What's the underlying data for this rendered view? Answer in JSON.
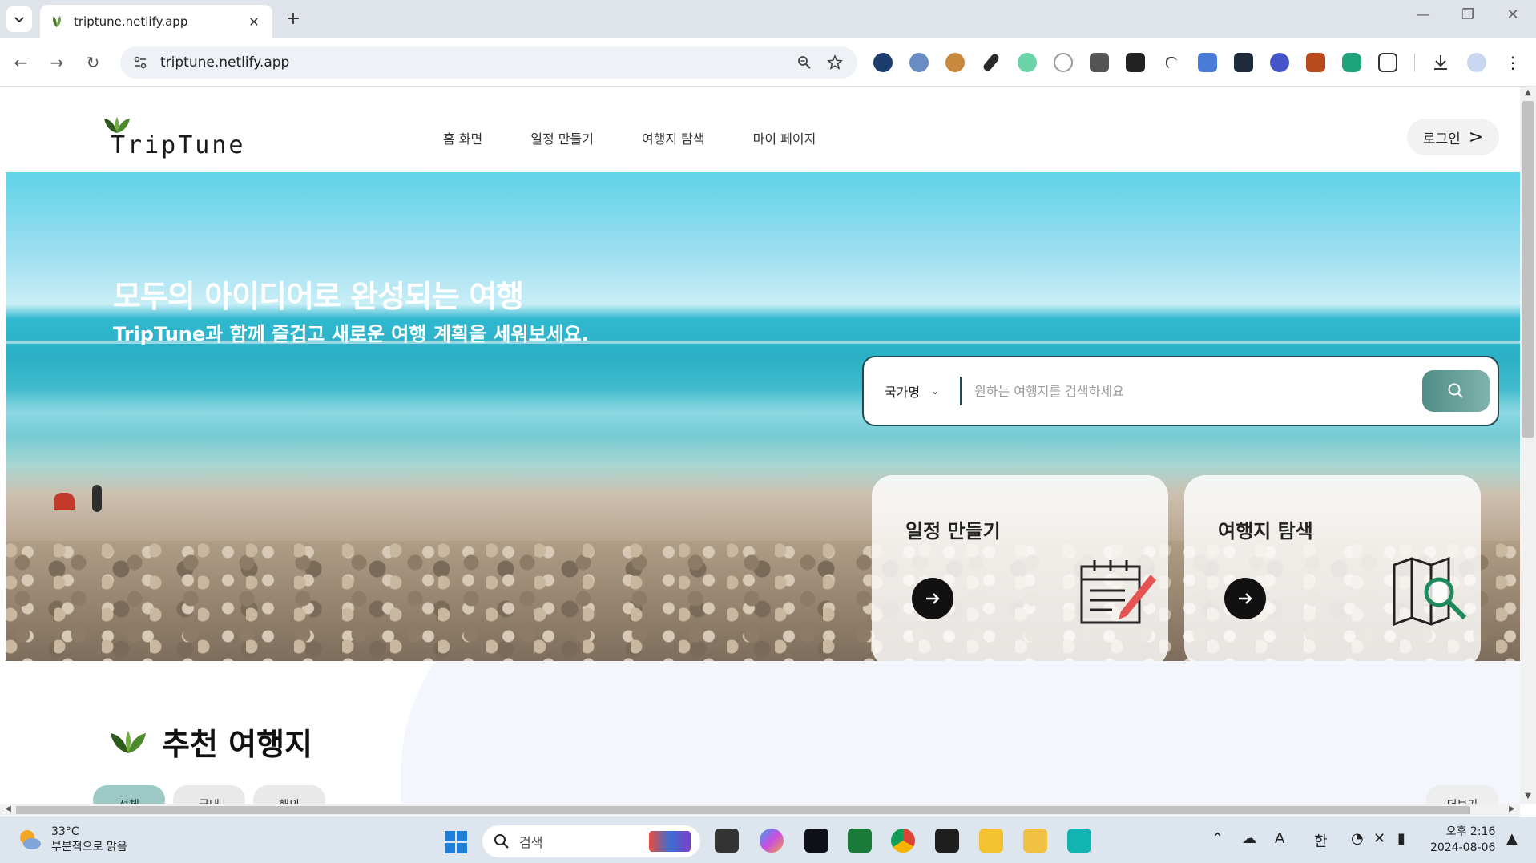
{
  "browser": {
    "tab_title": "triptune.netlify.app",
    "url": "triptune.netlify.app",
    "new_tab_symbol": "+",
    "close_symbol": "✕",
    "extensions": [
      "tasks-check-icon",
      "profile-avatar-icon",
      "cookie-icon",
      "eyedropper-icon",
      "colorzilla-icon",
      "compass-icon",
      "wappalyzer-icon",
      "spy-icon",
      "move-icon",
      "translate-icon",
      "react-devtools-icon",
      "network-icon",
      "lh-icon",
      "chat-icon",
      "puzzle-icon"
    ]
  },
  "site": {
    "logo_text": "TripTune",
    "menu": [
      "홈 화면",
      "일정 만들기",
      "여행지 탐색",
      "마이 페이지"
    ],
    "login_label": "로그인",
    "hero_title": "모두의 아이디어로 완성되는 여행",
    "hero_subtitle": "TripTune과 함께 즐겁고 새로운 여행 계획을 세워보세요.",
    "search": {
      "country_label": "국가명",
      "placeholder": "원하는 여행지를 검색하세요"
    },
    "cards": [
      {
        "title": "일정 만들기",
        "icon": "calendar-edit-icon"
      },
      {
        "title": "여행지 탐색",
        "icon": "map-search-icon"
      }
    ],
    "recommend_title": "추천 여행지",
    "filters": [
      "전체",
      "국내",
      "해외"
    ],
    "more_label": "더보기",
    "colors": {
      "accent": "#1e4b50",
      "search_button": "#5f9c94",
      "active_chip": "#9cc9c5"
    }
  },
  "taskbar": {
    "weather_temp": "33°C",
    "weather_desc": "부분적으로 맑음",
    "search_label": "검색",
    "ime": "한",
    "font_indicator": "A",
    "time": "오후 2:16",
    "date": "2024-08-06"
  }
}
